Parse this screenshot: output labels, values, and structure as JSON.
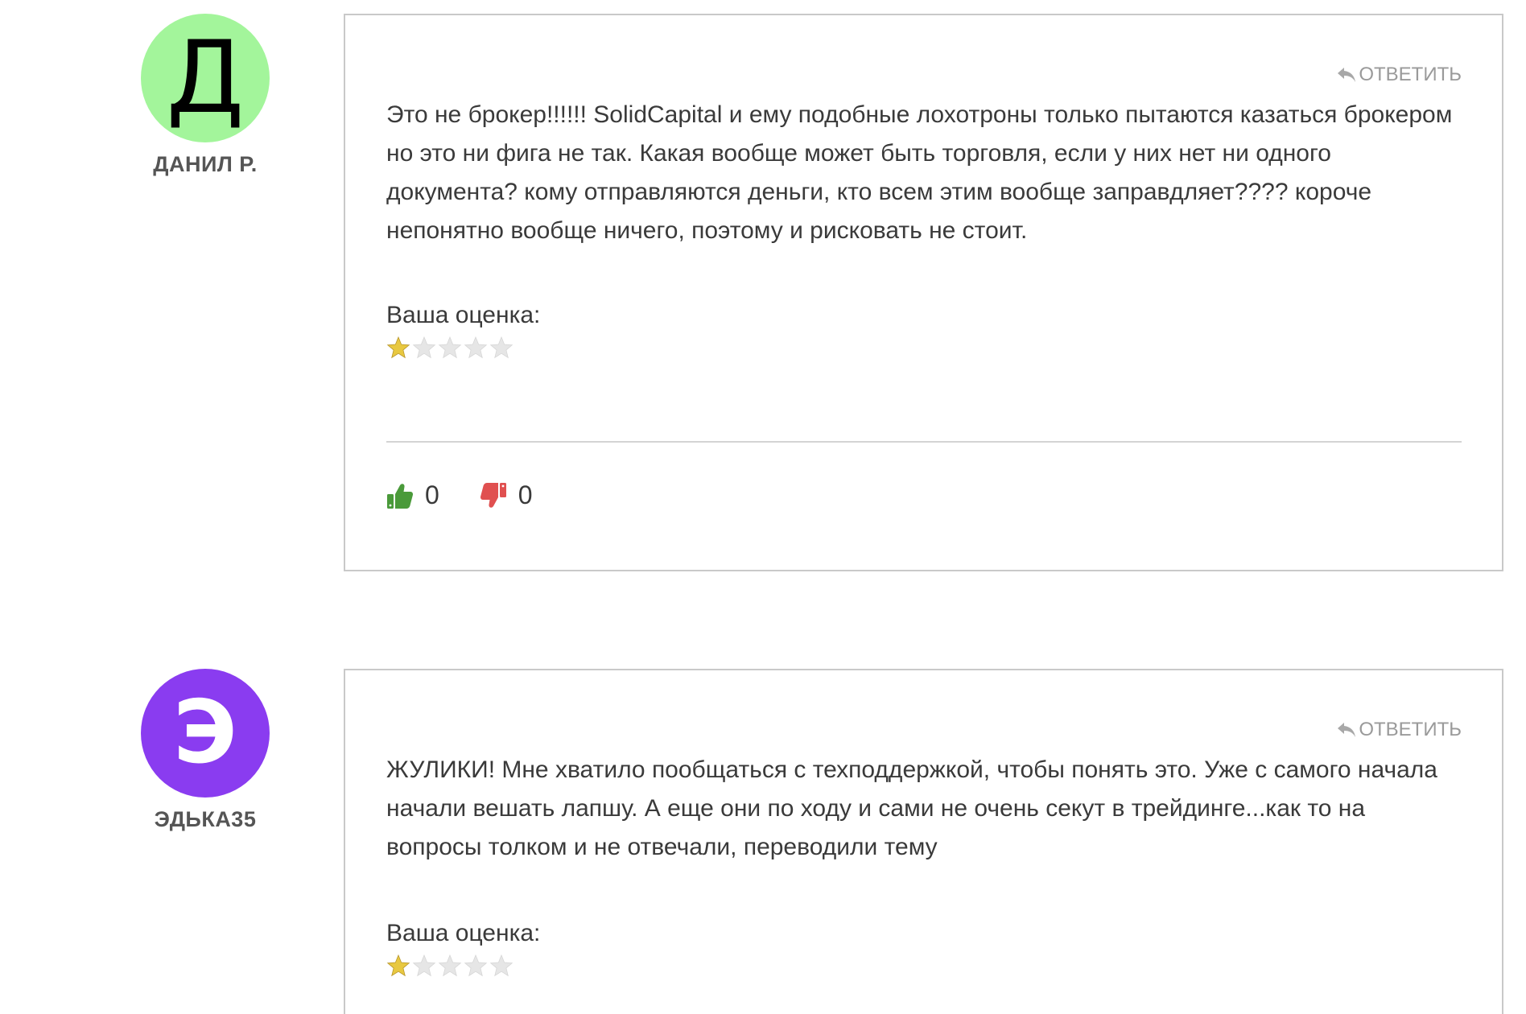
{
  "comments": [
    {
      "avatar_letter": "Д",
      "avatar_bg": "#a3f59b",
      "avatar_fg": "#000000",
      "author": "ДАНИЛ Р.",
      "reply_label": "ОТВЕТИТЬ",
      "text": "Это не брокер!!!!!! SolidCapital и ему подобные лохотроны только пытаются казаться брокером но это ни фига не так. Какая вообще может быть торговля, если у них нет ни одного документа? кому отправляются деньги, кто всем этим вообще заправдляет???? короче непонятно вообще ничего, поэтому и рисковать не стоит.",
      "rating_label": "Ваша оценка:",
      "rating": 1,
      "rating_max": 5,
      "likes": "0",
      "dislikes": "0"
    },
    {
      "avatar_letter": "Э",
      "avatar_bg": "#8a3cf0",
      "avatar_fg": "#ffffff",
      "author": "ЭДЬКА35",
      "reply_label": "ОТВЕТИТЬ",
      "text": "ЖУЛИКИ! Мне хватило пообщаться с техподдержкой, чтобы понять это. Уже с самого начала начали вешать лапшу. А еще они по ходу и сами не очень секут в трейдинге...как то на вопросы толком и не отвечали, переводили тему",
      "rating_label": "Ваша оценка:",
      "rating": 1,
      "rating_max": 5
    }
  ],
  "colors": {
    "like": "#4a9a3a",
    "dislike": "#e05050",
    "star_filled": "#e8c840",
    "star_empty": "#e6e6e6",
    "border": "#c9c9c9"
  },
  "icons": {
    "reply": "reply-arrow-icon",
    "like": "thumbs-up-icon",
    "dislike": "thumbs-down-icon",
    "star": "star-icon"
  }
}
